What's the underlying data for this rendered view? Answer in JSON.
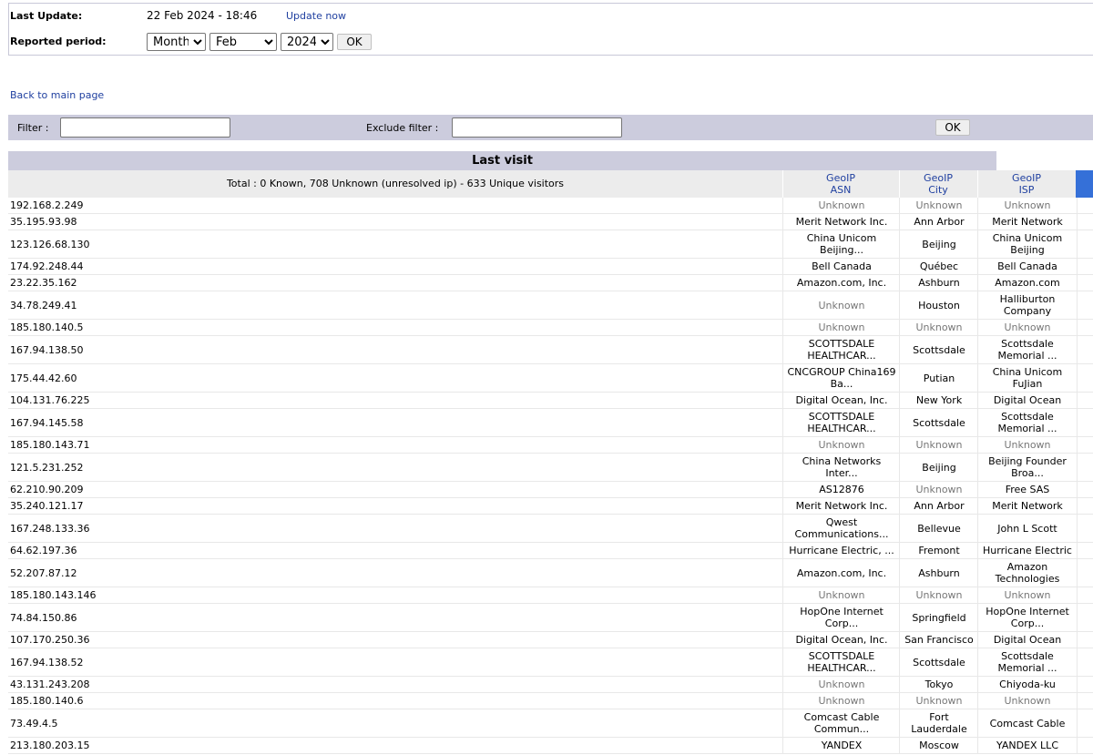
{
  "header": {
    "last_update_label": "Last Update:",
    "last_update_value": "22 Feb 2024 - 18:46",
    "update_now": "Update now",
    "period_label": "Reported period:",
    "period_type": "Month",
    "month": "Feb",
    "year": "2024",
    "ok": "OK"
  },
  "back_link": "Back to main page",
  "filter": {
    "filter_label": "Filter :",
    "exclude_label": "Exclude filter :",
    "ok": "OK"
  },
  "section_title": "Last visit",
  "table": {
    "total_text": "Total : 0 Known, 708 Unknown (unresolved ip) - 633 Unique visitors",
    "columns": [
      {
        "line1": "GeoIP",
        "line2": "ASN"
      },
      {
        "line1": "GeoIP",
        "line2": "City"
      },
      {
        "line1": "GeoIP",
        "line2": "ISP"
      }
    ],
    "rows": [
      {
        "ip": "192.168.2.249",
        "asn": "Unknown",
        "city": "Unknown",
        "isp": "Unknown"
      },
      {
        "ip": "35.195.93.98",
        "asn": "Merit Network Inc.",
        "city": "Ann Arbor",
        "isp": "Merit Network"
      },
      {
        "ip": "123.126.68.130",
        "asn": "China Unicom\nBeijing...",
        "city": "Beijing",
        "isp": "China Unicom\nBeijing"
      },
      {
        "ip": "174.92.248.44",
        "asn": "Bell Canada",
        "city": "Québec",
        "isp": "Bell Canada"
      },
      {
        "ip": "23.22.35.162",
        "asn": "Amazon.com, Inc.",
        "city": "Ashburn",
        "isp": "Amazon.com"
      },
      {
        "ip": "34.78.249.41",
        "asn": "Unknown",
        "city": "Houston",
        "isp": "Halliburton\nCompany"
      },
      {
        "ip": "185.180.140.5",
        "asn": "Unknown",
        "city": "Unknown",
        "isp": "Unknown"
      },
      {
        "ip": "167.94.138.50",
        "asn": "SCOTTSDALE\nHEALTHCAR...",
        "city": "Scottsdale",
        "isp": "Scottsdale\nMemorial ..."
      },
      {
        "ip": "175.44.42.60",
        "asn": "CNCGROUP China169\nBa...",
        "city": "Putian",
        "isp": "China Unicom\nFuJian"
      },
      {
        "ip": "104.131.76.225",
        "asn": "Digital Ocean, Inc.",
        "city": "New York",
        "isp": "Digital Ocean"
      },
      {
        "ip": "167.94.145.58",
        "asn": "SCOTTSDALE\nHEALTHCAR...",
        "city": "Scottsdale",
        "isp": "Scottsdale\nMemorial ..."
      },
      {
        "ip": "185.180.143.71",
        "asn": "Unknown",
        "city": "Unknown",
        "isp": "Unknown"
      },
      {
        "ip": "121.5.231.252",
        "asn": "China Networks\nInter...",
        "city": "Beijing",
        "isp": "Beijing Founder\nBroa..."
      },
      {
        "ip": "62.210.90.209",
        "asn": "AS12876",
        "city": "Unknown",
        "isp": "Free SAS"
      },
      {
        "ip": "35.240.121.17",
        "asn": "Merit Network Inc.",
        "city": "Ann Arbor",
        "isp": "Merit Network"
      },
      {
        "ip": "167.248.133.36",
        "asn": "Qwest\nCommunications...",
        "city": "Bellevue",
        "isp": "John L Scott"
      },
      {
        "ip": "64.62.197.36",
        "asn": "Hurricane Electric, ...",
        "city": "Fremont",
        "isp": "Hurricane Electric"
      },
      {
        "ip": "52.207.87.12",
        "asn": "Amazon.com, Inc.",
        "city": "Ashburn",
        "isp": "Amazon\nTechnologies"
      },
      {
        "ip": "185.180.143.146",
        "asn": "Unknown",
        "city": "Unknown",
        "isp": "Unknown"
      },
      {
        "ip": "74.84.150.86",
        "asn": "HopOne Internet\nCorp...",
        "city": "Springfield",
        "isp": "HopOne Internet\nCorp..."
      },
      {
        "ip": "107.170.250.36",
        "asn": "Digital Ocean, Inc.",
        "city": "San Francisco",
        "isp": "Digital Ocean"
      },
      {
        "ip": "167.94.138.52",
        "asn": "SCOTTSDALE\nHEALTHCAR...",
        "city": "Scottsdale",
        "isp": "Scottsdale\nMemorial ..."
      },
      {
        "ip": "43.131.243.208",
        "asn": "Unknown",
        "city": "Tokyo",
        "isp": "Chiyoda-ku"
      },
      {
        "ip": "185.180.140.6",
        "asn": "Unknown",
        "city": "Unknown",
        "isp": "Unknown"
      },
      {
        "ip": "73.49.4.5",
        "asn": "Comcast Cable\nCommun...",
        "city": "Fort\nLauderdale",
        "isp": "Comcast Cable"
      },
      {
        "ip": "213.180.203.15",
        "asn": "YANDEX",
        "city": "Moscow",
        "isp": "YANDEX LLC"
      }
    ]
  }
}
